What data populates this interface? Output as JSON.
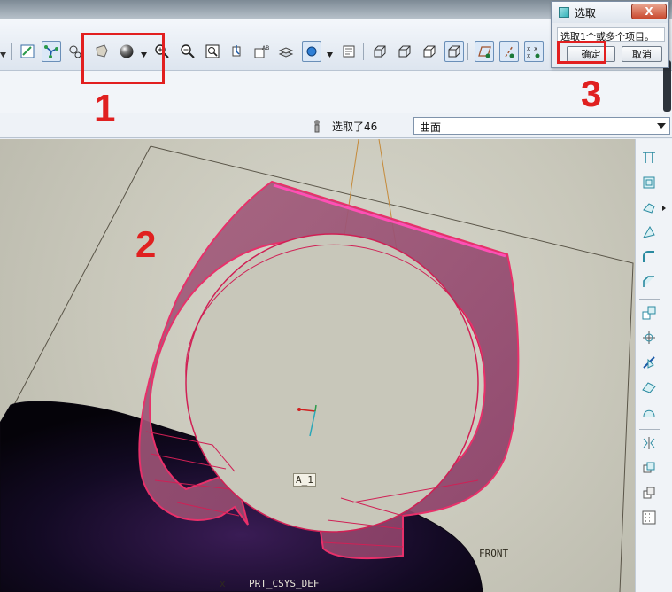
{
  "status": {
    "selected_text": "选取了46",
    "filter_value": "曲面"
  },
  "dialog": {
    "title": "选取",
    "message": "选取1个或多个项目。",
    "ok_label": "确定",
    "cancel_label": "取消",
    "close_label": "X"
  },
  "viewport": {
    "axis_label": "A_1",
    "front_label": "FRONT",
    "csys_label": "PRT_CSYS_DEF",
    "csys_prefix": "x"
  },
  "annotations": {
    "one": "1",
    "two": "2",
    "three": "3"
  },
  "colors": {
    "annotation_red": "#e21f1f",
    "selection_pink": "#e8306a"
  },
  "icons": {
    "toolbar": [
      "repaint-icon",
      "datum-display-icon",
      "spin-center-icon",
      "shading-mode-icon",
      "sphere-shading-icon",
      "zoom-in-icon",
      "zoom-out-icon",
      "refit-icon",
      "orient-icon",
      "saved-views-icon",
      "layers-icon",
      "appearance-icon",
      "model-tree-icon",
      "wireframe-icon",
      "hidden-line-icon",
      "no-hidden-icon",
      "shaded-icon",
      "datum-planes-icon",
      "datum-axes-icon",
      "datum-points-icon"
    ],
    "rightbar": [
      "sketch-icon",
      "extrude-icon",
      "revolve-icon",
      "sweep-icon",
      "round-icon",
      "chamfer-icon",
      "pattern-icon",
      "mirror-icon",
      "trim-icon",
      "merge-icon",
      "boundary-icon",
      "offset-icon",
      "thicken-icon",
      "solidify-icon",
      "grid-icon"
    ]
  }
}
